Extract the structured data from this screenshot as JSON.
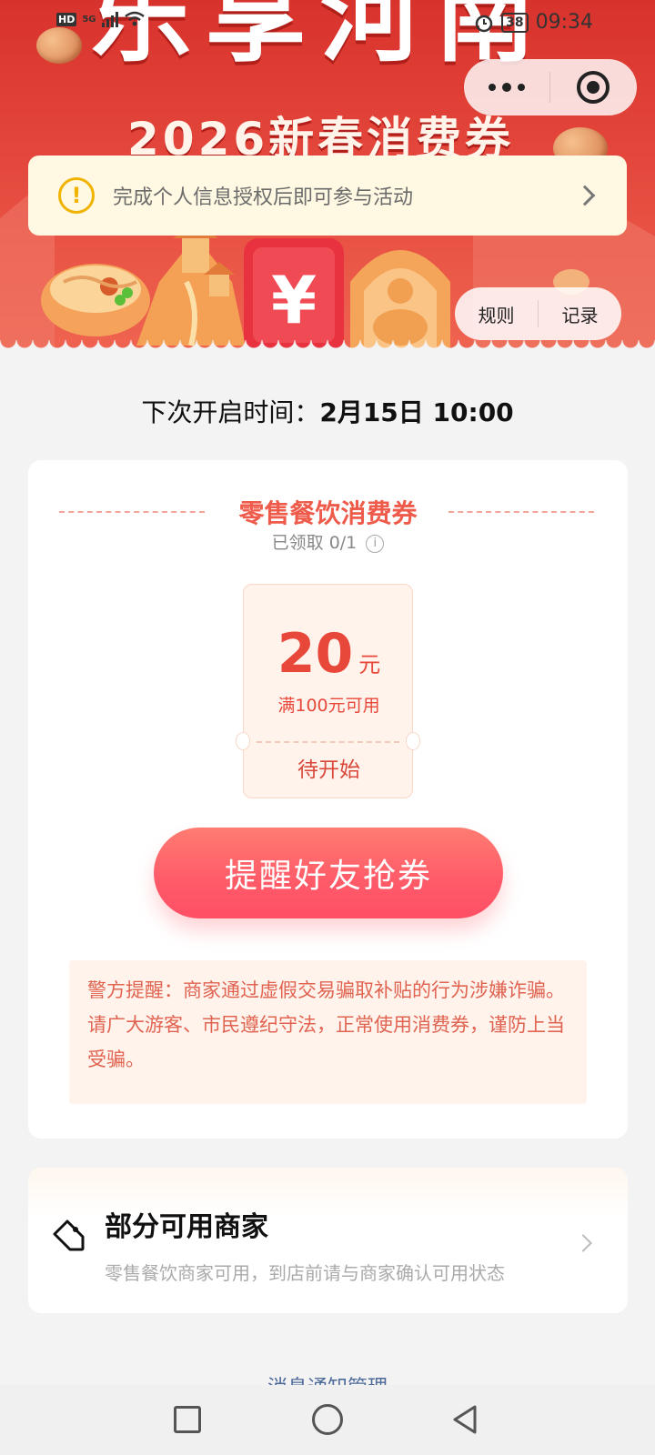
{
  "status_bar": {
    "network_badge": "HD",
    "network_type": "5G",
    "battery": "38",
    "time": "09:34"
  },
  "hero": {
    "title": "乐享河南",
    "subtitle": "2026新春消费券",
    "icons": [
      "coin",
      "temple-tower",
      "yuan-ticket",
      "buddha-statue",
      "noodle-bowl"
    ]
  },
  "capsule": {
    "more_icon": "more-dots-icon",
    "close_icon": "target-close-icon"
  },
  "auth_notice": {
    "text": "完成个人信息授权后即可参与活动"
  },
  "top_links": {
    "rules": "规则",
    "records": "记录"
  },
  "next_open": {
    "label": "下次开启时间：",
    "time": "2月15日 10:00"
  },
  "coupon_section": {
    "title": "零售餐饮消费券",
    "claimed_label": "已领取 0/1",
    "coupon": {
      "amount": "20",
      "unit": "元",
      "condition": "满100元可用",
      "status": "待开始"
    },
    "remind_button": "提醒好友抢券",
    "police_note": "警方提醒：商家通过虚假交易骗取补贴的行为涉嫌诈骗。请广大游客、市民遵纪守法，正常使用消费券，谨防上当受骗。"
  },
  "merchant": {
    "title": "部分可用商家",
    "description": "零售餐饮商家可用，到店前请与商家确认可用状态"
  },
  "footer": {
    "message_manage": "消息通知管理"
  },
  "colors": {
    "brand_red": "#d8322c",
    "accent_coral": "#ef5b4a",
    "button_pink": "#ff5a68",
    "notice_bg": "#fff8e2",
    "link_blue": "#4d6a99"
  }
}
